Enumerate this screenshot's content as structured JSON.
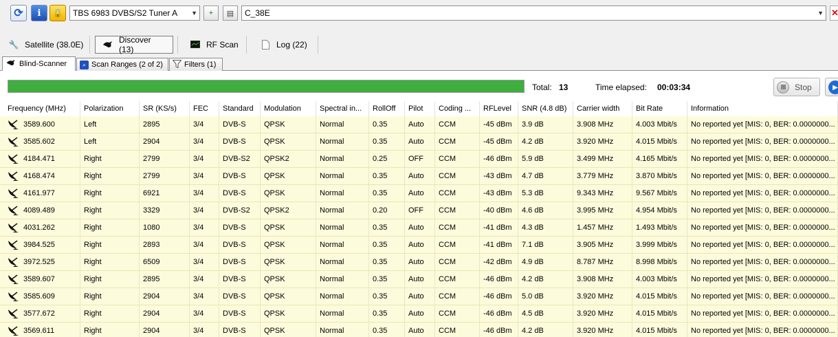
{
  "toolbar": {
    "tuner_select": "TBS 6983 DVBS/S2 Tuner A",
    "satellite_select": "C_38E"
  },
  "main_tabs": [
    {
      "label": "Satellite (38.0E)"
    },
    {
      "label": "Discover (13)"
    },
    {
      "label": "RF Scan"
    },
    {
      "label": "Log (22)"
    }
  ],
  "sub_tabs": [
    {
      "label": "Blind-Scanner"
    },
    {
      "label": "Scan Ranges (2 of 2)"
    },
    {
      "label": "Filters (1)"
    }
  ],
  "status": {
    "progress": 1.0,
    "total_label": "Total:",
    "total_value": "13",
    "elapsed_label": "Time elapsed:",
    "elapsed_value": "00:03:34",
    "stop_label": "Stop"
  },
  "table": {
    "columns": [
      "Frequency (MHz)",
      "Polarization",
      "SR (KS/s)",
      "FEC",
      "Standard",
      "Modulation",
      "Spectral in...",
      "RollOff",
      "Pilot",
      "Coding ...",
      "RFLevel",
      "SNR (4.8 dB)",
      "Carrier width",
      "Bit Rate",
      "Information"
    ],
    "rows": [
      [
        "3589.600",
        "Left",
        "2895",
        "3/4",
        "DVB-S",
        "QPSK",
        "Normal",
        "0.35",
        "Auto",
        "CCM",
        "-45 dBm",
        "3.9 dB",
        "3.908 MHz",
        "4.003 Mbit/s",
        "No reported yet [MIS: 0, BER: 0.0000000..."
      ],
      [
        "3585.602",
        "Left",
        "2904",
        "3/4",
        "DVB-S",
        "QPSK",
        "Normal",
        "0.35",
        "Auto",
        "CCM",
        "-45 dBm",
        "4.2 dB",
        "3.920 MHz",
        "4.015 Mbit/s",
        "No reported yet [MIS: 0, BER: 0.0000000..."
      ],
      [
        "4184.471",
        "Right",
        "2799",
        "3/4",
        "DVB-S2",
        "QPSK2",
        "Normal",
        "0.25",
        "OFF",
        "CCM",
        "-46 dBm",
        "5.9 dB",
        "3.499 MHz",
        "4.165 Mbit/s",
        "No reported yet [MIS: 0, BER: 0.0000000..."
      ],
      [
        "4168.474",
        "Right",
        "2799",
        "3/4",
        "DVB-S",
        "QPSK",
        "Normal",
        "0.35",
        "Auto",
        "CCM",
        "-43 dBm",
        "4.7 dB",
        "3.779 MHz",
        "3.870 Mbit/s",
        "No reported yet [MIS: 0, BER: 0.0000000..."
      ],
      [
        "4161.977",
        "Right",
        "6921",
        "3/4",
        "DVB-S",
        "QPSK",
        "Normal",
        "0.35",
        "Auto",
        "CCM",
        "-43 dBm",
        "5.3 dB",
        "9.343 MHz",
        "9.567 Mbit/s",
        "No reported yet [MIS: 0, BER: 0.0000000..."
      ],
      [
        "4089.489",
        "Right",
        "3329",
        "3/4",
        "DVB-S2",
        "QPSK2",
        "Normal",
        "0.20",
        "OFF",
        "CCM",
        "-40 dBm",
        "4.6 dB",
        "3.995 MHz",
        "4.954 Mbit/s",
        "No reported yet [MIS: 0, BER: 0.0000000..."
      ],
      [
        "4031.262",
        "Right",
        "1080",
        "3/4",
        "DVB-S",
        "QPSK",
        "Normal",
        "0.35",
        "Auto",
        "CCM",
        "-41 dBm",
        "4.3 dB",
        "1.457 MHz",
        "1.493 Mbit/s",
        "No reported yet [MIS: 0, BER: 0.0000000..."
      ],
      [
        "3984.525",
        "Right",
        "2893",
        "3/4",
        "DVB-S",
        "QPSK",
        "Normal",
        "0.35",
        "Auto",
        "CCM",
        "-41 dBm",
        "7.1 dB",
        "3.905 MHz",
        "3.999 Mbit/s",
        "No reported yet [MIS: 0, BER: 0.0000000..."
      ],
      [
        "3972.525",
        "Right",
        "6509",
        "3/4",
        "DVB-S",
        "QPSK",
        "Normal",
        "0.35",
        "Auto",
        "CCM",
        "-42 dBm",
        "4.9 dB",
        "8.787 MHz",
        "8.998 Mbit/s",
        "No reported yet [MIS: 0, BER: 0.0000000..."
      ],
      [
        "3589.607",
        "Right",
        "2895",
        "3/4",
        "DVB-S",
        "QPSK",
        "Normal",
        "0.35",
        "Auto",
        "CCM",
        "-46 dBm",
        "4.2 dB",
        "3.908 MHz",
        "4.003 Mbit/s",
        "No reported yet [MIS: 0, BER: 0.0000000..."
      ],
      [
        "3585.609",
        "Right",
        "2904",
        "3/4",
        "DVB-S",
        "QPSK",
        "Normal",
        "0.35",
        "Auto",
        "CCM",
        "-46 dBm",
        "5.0 dB",
        "3.920 MHz",
        "4.015 Mbit/s",
        "No reported yet [MIS: 0, BER: 0.0000000..."
      ],
      [
        "3577.672",
        "Right",
        "2904",
        "3/4",
        "DVB-S",
        "QPSK",
        "Normal",
        "0.35",
        "Auto",
        "CCM",
        "-46 dBm",
        "4.5 dB",
        "3.920 MHz",
        "4.015 Mbit/s",
        "No reported yet [MIS: 0, BER: 0.0000000..."
      ],
      [
        "3569.611",
        "Right",
        "2904",
        "3/4",
        "DVB-S",
        "QPSK",
        "Normal",
        "0.35",
        "Auto",
        "CCM",
        "-46 dBm",
        "4.2 dB",
        "3.920 MHz",
        "4.015 Mbit/s",
        "No reported yet [MIS: 0, BER: 0.0000000..."
      ]
    ]
  },
  "colors": {
    "row_bg": "#fcfbdc",
    "progress_fill": "#3fae3f",
    "accent": "#1d6bd6"
  }
}
